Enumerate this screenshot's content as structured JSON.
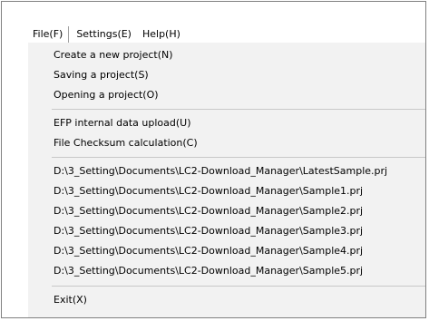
{
  "menubar": {
    "file": "File(F)",
    "settings": "Settings(E)",
    "help": "Help(H)"
  },
  "file_menu": {
    "new_project": "Create a new project(N)",
    "save_project": "Saving a project(S)",
    "open_project": "Opening a project(O)",
    "efp_upload": "EFP internal data upload(U)",
    "checksum": "File Checksum calculation(C)",
    "recent": [
      "D:\\3_Setting\\Documents\\LC2-Download_Manager\\LatestSample.prj",
      "D:\\3_Setting\\Documents\\LC2-Download_Manager\\Sample1.prj",
      "D:\\3_Setting\\Documents\\LC2-Download_Manager\\Sample2.prj",
      "D:\\3_Setting\\Documents\\LC2-Download_Manager\\Sample3.prj",
      "D:\\3_Setting\\Documents\\LC2-Download_Manager\\Sample4.prj",
      "D:\\3_Setting\\Documents\\LC2-Download_Manager\\Sample5.prj"
    ],
    "exit": "Exit(X)"
  }
}
